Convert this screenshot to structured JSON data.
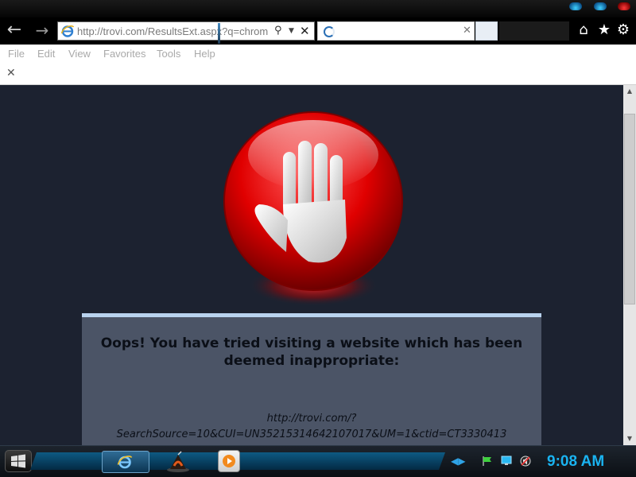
{
  "browser": {
    "address_url": "http://trovi.com/ResultsExt.aspx?q=chrom",
    "icons": {
      "back": "back-arrow-icon",
      "forward": "forward-arrow-icon",
      "search": "search-icon",
      "dropdown": "chevron-down-icon",
      "stop": "close-icon",
      "home": "home-icon",
      "favorites": "star-icon",
      "tools": "gear-icon"
    }
  },
  "menu": {
    "items": [
      "File",
      "Edit",
      "View",
      "Favorites",
      "Tools",
      "Help"
    ]
  },
  "page": {
    "warning_title": "Oops! You have tried visiting a website which has been deemed inappropriate:",
    "blocked_url": "http://trovi.com/?SearchSource=10&CUI=UN35215314642107017&UM=1&ctid=CT3330413",
    "colors": {
      "background": "#1c2230",
      "panel": "#4b5466",
      "panel_border": "#b9d3ee",
      "stop_sign": "#e00000"
    }
  },
  "taskbar": {
    "clock": "9:08 AM",
    "clock_color": "#1ab3f0"
  }
}
